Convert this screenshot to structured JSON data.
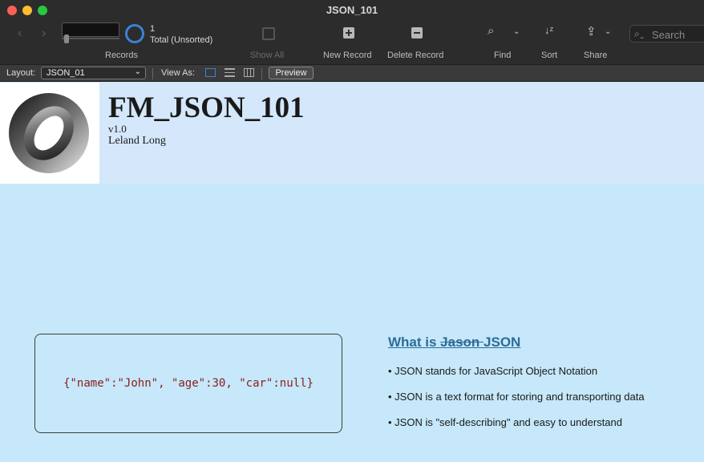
{
  "window": {
    "title": "JSON_101"
  },
  "toolbar": {
    "record_count": "1",
    "record_total": "Total (Unsorted)",
    "records_label": "Records",
    "show_all_label": "Show All",
    "new_record_label": "New Record",
    "delete_record_label": "Delete Record",
    "find_label": "Find",
    "sort_label": "Sort",
    "share_label": "Share",
    "search_placeholder": "Search"
  },
  "layoutbar": {
    "layout_label": "Layout:",
    "layout_value": "JSON_01",
    "view_as_label": "View As:",
    "preview_label": "Preview"
  },
  "header": {
    "title": "FM_JSON_101",
    "version": "v1.0",
    "author": "Leland Long"
  },
  "content": {
    "code_example": "{\"name\":\"John\", \"age\":30, \"car\":null}",
    "heading_prefix": "What is ",
    "heading_struck": "Jason ",
    "heading_suffix": "JSON",
    "bullets": [
      "• JSON stands for JavaScript Object Notation",
      "• JSON is a text format for storing and transporting data",
      "• JSON is \"self-describing\" and easy to understand"
    ]
  },
  "colors": {
    "accent": "#3b82d6",
    "content_bg": "#c6e8fa",
    "header_bg": "#d4e7fb",
    "heading": "#2e6b96",
    "code": "#8b1d1d"
  }
}
